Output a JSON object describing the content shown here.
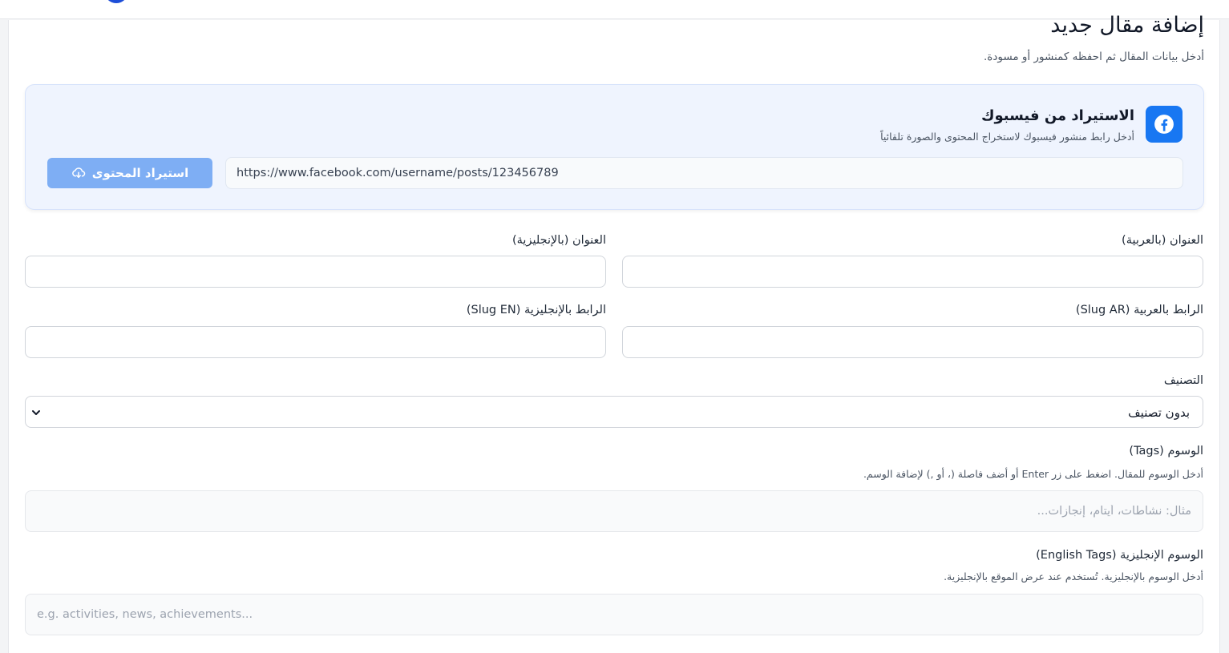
{
  "page": {
    "title": "إضافة مقال جديد",
    "subtitle": "أدخل بيانات المقال ثم احفظه كمنشور أو مسودة."
  },
  "facebook_import": {
    "icon": "facebook-icon",
    "title": "الاستيراد من فيسبوك",
    "description": "أدخل رابط منشور فيسبوك لاستخراج المحتوى والصورة تلقائياً",
    "url_value": "https://www.facebook.com/username/posts/123456789",
    "button_label": "استيراد المحتوى",
    "button_icon": "cloud-download-icon",
    "accent": "#1877f2",
    "button_color": "#7eaef4"
  },
  "form": {
    "title_ar_label": "العنوان (بالعربية)",
    "title_ar_value": "",
    "title_en_label": "العنوان (بالإنجليزية)",
    "title_en_value": "",
    "slug_ar_label": "الرابط بالعربية (Slug AR)",
    "slug_ar_value": "",
    "slug_en_label": "الرابط بالإنجليزية (Slug EN)",
    "slug_en_value": "",
    "category_label": "التصنيف",
    "category_value": "بدون تصنيف",
    "tags_label": "الوسوم (Tags)",
    "tags_hint": "أدخل الوسوم للمقال. اضغط على زر Enter أو أضف فاصلة (، أو ,) لإضافة الوسم.",
    "tags_placeholder": "مثال: نشاطات، أيتام، إنجازات...",
    "en_tags_label": "الوسوم الإنجليزية (English Tags)",
    "en_tags_hint": "أدخل الوسوم بالإنجليزية. تُستخدم عند عرض الموقع بالإنجليزية.",
    "en_tags_placeholder": "e.g. activities, news, achievements..."
  }
}
